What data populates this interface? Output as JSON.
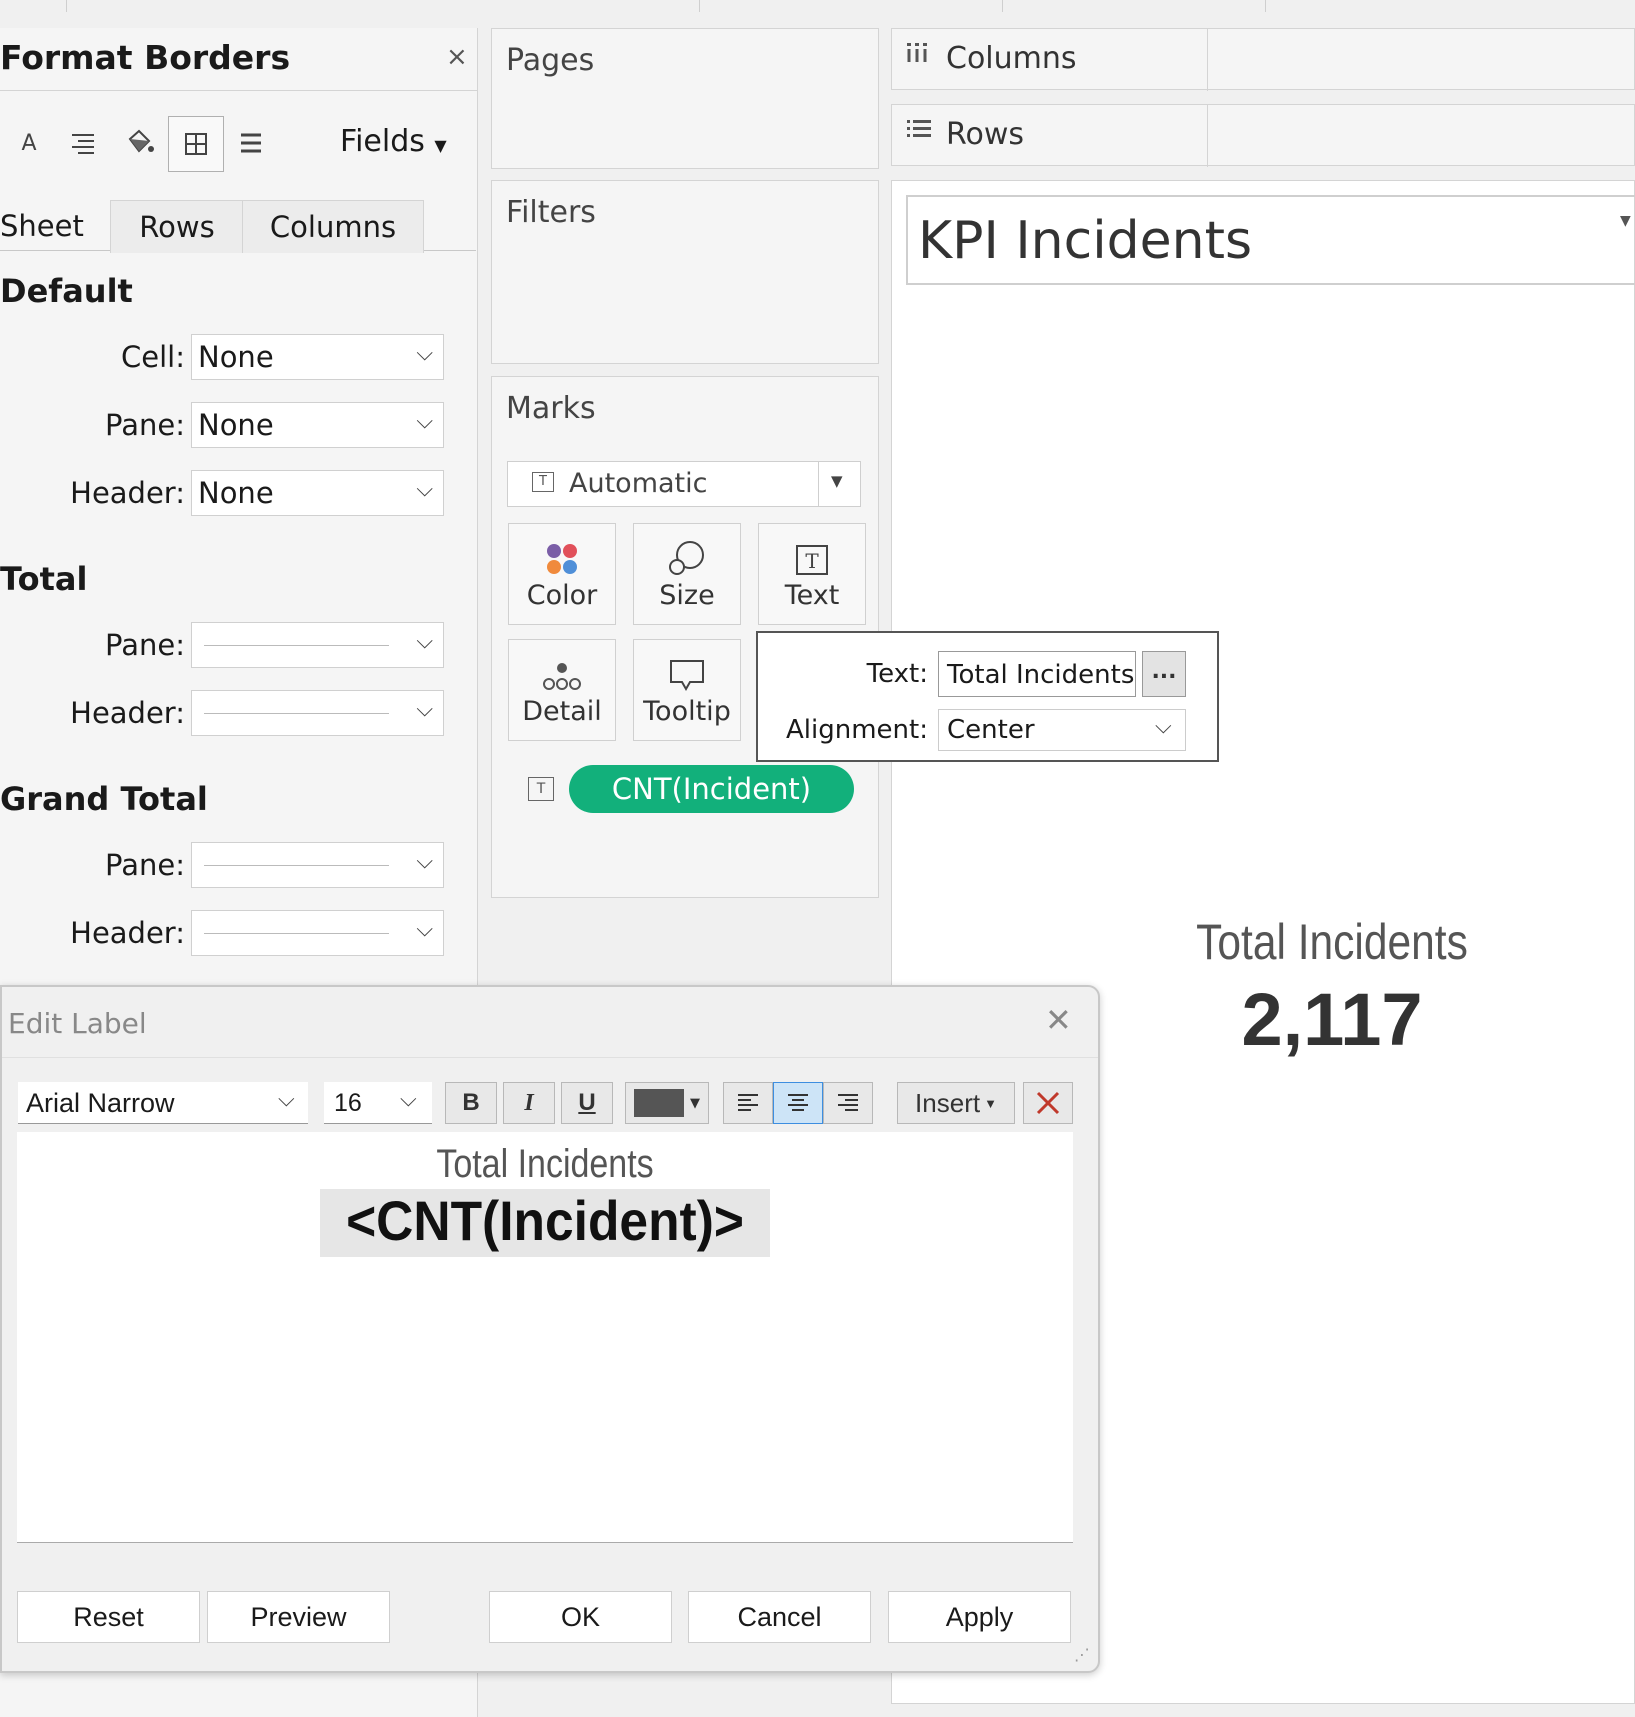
{
  "format_pane": {
    "title": "Format Borders",
    "close": "×",
    "fields_label": "Fields",
    "tabs": [
      "Sheet",
      "Rows",
      "Columns"
    ],
    "sections": {
      "default": {
        "heading": "Default",
        "cell_label": "Cell:",
        "cell_value": "None",
        "pane_label": "Pane:",
        "pane_value": "None",
        "header_label": "Header:",
        "header_value": "None"
      },
      "total": {
        "heading": "Total",
        "pane_label": "Pane:",
        "header_label": "Header:"
      },
      "grand_total": {
        "heading": "Grand Total",
        "pane_label": "Pane:",
        "header_label": "Header:"
      }
    }
  },
  "cards": {
    "pages": "Pages",
    "filters": "Filters",
    "marks": {
      "title": "Marks",
      "type": "Automatic",
      "buttons": {
        "color": "Color",
        "size": "Size",
        "text": "Text",
        "detail": "Detail",
        "tooltip": "Tooltip"
      },
      "pill": "CNT(Incident)",
      "pill_color": "#12b07b"
    }
  },
  "text_popup": {
    "text_label": "Text:",
    "text_value": "Total Incidents",
    "more": "...",
    "alignment_label": "Alignment:",
    "alignment_value": "Center"
  },
  "shelves": {
    "columns": "Columns",
    "rows": "Rows"
  },
  "view": {
    "title": "KPI Incidents",
    "kpi_label": "Total Incidents",
    "kpi_value": "2,117"
  },
  "edit_label": {
    "title": "Edit Label",
    "font": "Arial Narrow",
    "size": "16",
    "bold": "B",
    "italic": "I",
    "underline": "U",
    "insert": "Insert",
    "line1": "Total Incidents",
    "line2": "<CNT(Incident)>",
    "buttons": {
      "reset": "Reset",
      "preview": "Preview",
      "ok": "OK",
      "cancel": "Cancel",
      "apply": "Apply"
    }
  }
}
